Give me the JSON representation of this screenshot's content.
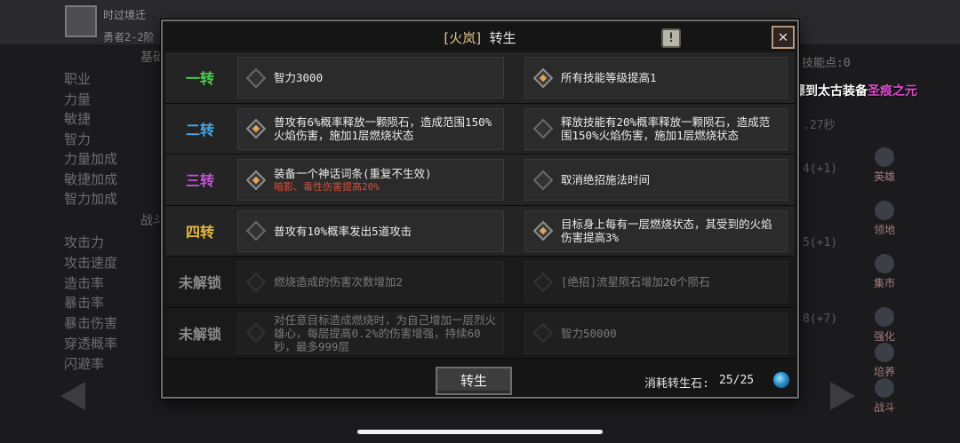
{
  "background": {
    "player_name": "时过境迁",
    "player_rank": "勇者2-2阶",
    "section_basic": "基础",
    "section_battle": "战斗",
    "skill_points_label": "技能点:0",
    "stats_basic": [
      "职业",
      "力量",
      "敏捷",
      "智力",
      "力量加成",
      "敏捷加成",
      "智力加成"
    ],
    "stats_battle": [
      "攻击力",
      "攻击速度",
      "造击率",
      "暴击率",
      "暴击伤害",
      "穿透概率",
      "闪避率"
    ],
    "mid_values": [
      ".27秒",
      "4(+1)",
      "5(+1)",
      "8(+7)"
    ],
    "right_nav": [
      "英雄",
      "领地",
      "集市",
      "强化",
      "培养",
      "战斗"
    ]
  },
  "broadcast": {
    "text": "运气爆棚！玩家七个隆冬强，在血缘诅咒爆到太古装备",
    "highlight": "圣痕之元"
  },
  "modal": {
    "title_tag": "[火岚]",
    "title": "转生",
    "info_icon": "exclamation-icon",
    "close_icon": "close-icon",
    "rows": [
      {
        "tier": "一转",
        "tier_color": "#4cd04c",
        "state": "active",
        "left": {
          "text": "智力3000",
          "sub": "",
          "on": false
        },
        "right": {
          "text": "所有技能等级提高1",
          "sub": "",
          "on": true
        }
      },
      {
        "tier": "二转",
        "tier_color": "#4aa6e8",
        "state": "active",
        "left": {
          "text": "普攻有6%概率释放一颗陨石，造成范围150%火焰伤害，施加1层燃烧状态",
          "sub": "",
          "on": true
        },
        "right": {
          "text": "释放技能有20%概率释放一颗陨石，造成范围150%火焰伤害，施加1层燃烧状态",
          "sub": "",
          "on": false
        }
      },
      {
        "tier": "三转",
        "tier_color": "#c655d8",
        "state": "active",
        "left": {
          "text": "装备一个神话词条(重复不生效)",
          "sub": "暗影、毒性伤害提高20%",
          "on": true
        },
        "right": {
          "text": "取消绝招施法时间",
          "sub": "",
          "on": false
        }
      },
      {
        "tier": "四转",
        "tier_color": "#e6b840",
        "state": "active",
        "left": {
          "text": "普攻有10%概率发出5道攻击",
          "sub": "",
          "on": false
        },
        "right": {
          "text": "目标身上每有一层燃烧状态，其受到的火焰伤害提高3%",
          "sub": "",
          "on": true
        }
      },
      {
        "tier": "未解锁",
        "tier_color": "#8a8a8a",
        "state": "locked",
        "left": {
          "text": "燃烧造成的伤害次数增加2",
          "sub": "",
          "on": false
        },
        "right": {
          "text": "[绝招]流星陨石增加20个陨石",
          "sub": "",
          "on": false
        }
      },
      {
        "tier": "未解锁",
        "tier_color": "#8a8a8a",
        "state": "locked",
        "left": {
          "text": "对任意目标造成燃烧时，为自己增加一层烈火雄心，每层提高0.2%的伤害增强，持续60秒，最多999层",
          "sub": "",
          "on": false
        },
        "right": {
          "text": "智力50000",
          "sub": "",
          "on": false
        }
      }
    ],
    "footer": {
      "rebirth_button": "转生",
      "cost_label": "消耗转生石:",
      "cost_value": "25/25",
      "stone_icon": "rebirth-stone-icon"
    }
  }
}
